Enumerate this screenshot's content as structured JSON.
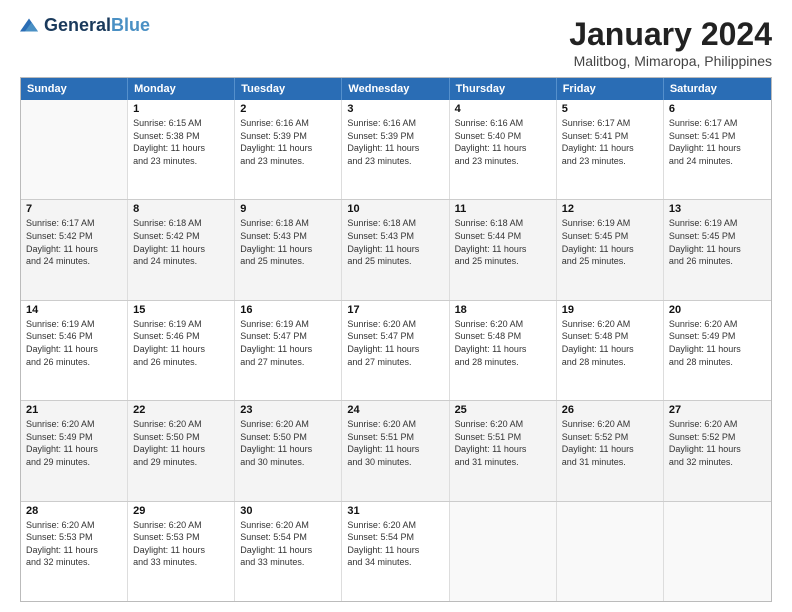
{
  "header": {
    "logo_line1": "General",
    "logo_line2": "Blue",
    "title": "January 2024",
    "subtitle": "Malitbog, Mimaropa, Philippines"
  },
  "days": [
    "Sunday",
    "Monday",
    "Tuesday",
    "Wednesday",
    "Thursday",
    "Friday",
    "Saturday"
  ],
  "weeks": [
    [
      {
        "day": "",
        "sunrise": "",
        "sunset": "",
        "daylight": ""
      },
      {
        "day": "1",
        "sunrise": "6:15 AM",
        "sunset": "5:38 PM",
        "daylight": "11 hours and 23 minutes."
      },
      {
        "day": "2",
        "sunrise": "6:16 AM",
        "sunset": "5:39 PM",
        "daylight": "11 hours and 23 minutes."
      },
      {
        "day": "3",
        "sunrise": "6:16 AM",
        "sunset": "5:39 PM",
        "daylight": "11 hours and 23 minutes."
      },
      {
        "day": "4",
        "sunrise": "6:16 AM",
        "sunset": "5:40 PM",
        "daylight": "11 hours and 23 minutes."
      },
      {
        "day": "5",
        "sunrise": "6:17 AM",
        "sunset": "5:41 PM",
        "daylight": "11 hours and 23 minutes."
      },
      {
        "day": "6",
        "sunrise": "6:17 AM",
        "sunset": "5:41 PM",
        "daylight": "11 hours and 24 minutes."
      }
    ],
    [
      {
        "day": "7",
        "sunrise": "6:17 AM",
        "sunset": "5:42 PM",
        "daylight": "11 hours and 24 minutes."
      },
      {
        "day": "8",
        "sunrise": "6:18 AM",
        "sunset": "5:42 PM",
        "daylight": "11 hours and 24 minutes."
      },
      {
        "day": "9",
        "sunrise": "6:18 AM",
        "sunset": "5:43 PM",
        "daylight": "11 hours and 25 minutes."
      },
      {
        "day": "10",
        "sunrise": "6:18 AM",
        "sunset": "5:43 PM",
        "daylight": "11 hours and 25 minutes."
      },
      {
        "day": "11",
        "sunrise": "6:18 AM",
        "sunset": "5:44 PM",
        "daylight": "11 hours and 25 minutes."
      },
      {
        "day": "12",
        "sunrise": "6:19 AM",
        "sunset": "5:45 PM",
        "daylight": "11 hours and 25 minutes."
      },
      {
        "day": "13",
        "sunrise": "6:19 AM",
        "sunset": "5:45 PM",
        "daylight": "11 hours and 26 minutes."
      }
    ],
    [
      {
        "day": "14",
        "sunrise": "6:19 AM",
        "sunset": "5:46 PM",
        "daylight": "11 hours and 26 minutes."
      },
      {
        "day": "15",
        "sunrise": "6:19 AM",
        "sunset": "5:46 PM",
        "daylight": "11 hours and 26 minutes."
      },
      {
        "day": "16",
        "sunrise": "6:19 AM",
        "sunset": "5:47 PM",
        "daylight": "11 hours and 27 minutes."
      },
      {
        "day": "17",
        "sunrise": "6:20 AM",
        "sunset": "5:47 PM",
        "daylight": "11 hours and 27 minutes."
      },
      {
        "day": "18",
        "sunrise": "6:20 AM",
        "sunset": "5:48 PM",
        "daylight": "11 hours and 28 minutes."
      },
      {
        "day": "19",
        "sunrise": "6:20 AM",
        "sunset": "5:48 PM",
        "daylight": "11 hours and 28 minutes."
      },
      {
        "day": "20",
        "sunrise": "6:20 AM",
        "sunset": "5:49 PM",
        "daylight": "11 hours and 28 minutes."
      }
    ],
    [
      {
        "day": "21",
        "sunrise": "6:20 AM",
        "sunset": "5:49 PM",
        "daylight": "11 hours and 29 minutes."
      },
      {
        "day": "22",
        "sunrise": "6:20 AM",
        "sunset": "5:50 PM",
        "daylight": "11 hours and 29 minutes."
      },
      {
        "day": "23",
        "sunrise": "6:20 AM",
        "sunset": "5:50 PM",
        "daylight": "11 hours and 30 minutes."
      },
      {
        "day": "24",
        "sunrise": "6:20 AM",
        "sunset": "5:51 PM",
        "daylight": "11 hours and 30 minutes."
      },
      {
        "day": "25",
        "sunrise": "6:20 AM",
        "sunset": "5:51 PM",
        "daylight": "11 hours and 31 minutes."
      },
      {
        "day": "26",
        "sunrise": "6:20 AM",
        "sunset": "5:52 PM",
        "daylight": "11 hours and 31 minutes."
      },
      {
        "day": "27",
        "sunrise": "6:20 AM",
        "sunset": "5:52 PM",
        "daylight": "11 hours and 32 minutes."
      }
    ],
    [
      {
        "day": "28",
        "sunrise": "6:20 AM",
        "sunset": "5:53 PM",
        "daylight": "11 hours and 32 minutes."
      },
      {
        "day": "29",
        "sunrise": "6:20 AM",
        "sunset": "5:53 PM",
        "daylight": "11 hours and 33 minutes."
      },
      {
        "day": "30",
        "sunrise": "6:20 AM",
        "sunset": "5:54 PM",
        "daylight": "11 hours and 33 minutes."
      },
      {
        "day": "31",
        "sunrise": "6:20 AM",
        "sunset": "5:54 PM",
        "daylight": "11 hours and 34 minutes."
      },
      {
        "day": "",
        "sunrise": "",
        "sunset": "",
        "daylight": ""
      },
      {
        "day": "",
        "sunrise": "",
        "sunset": "",
        "daylight": ""
      },
      {
        "day": "",
        "sunrise": "",
        "sunset": "",
        "daylight": ""
      }
    ]
  ]
}
